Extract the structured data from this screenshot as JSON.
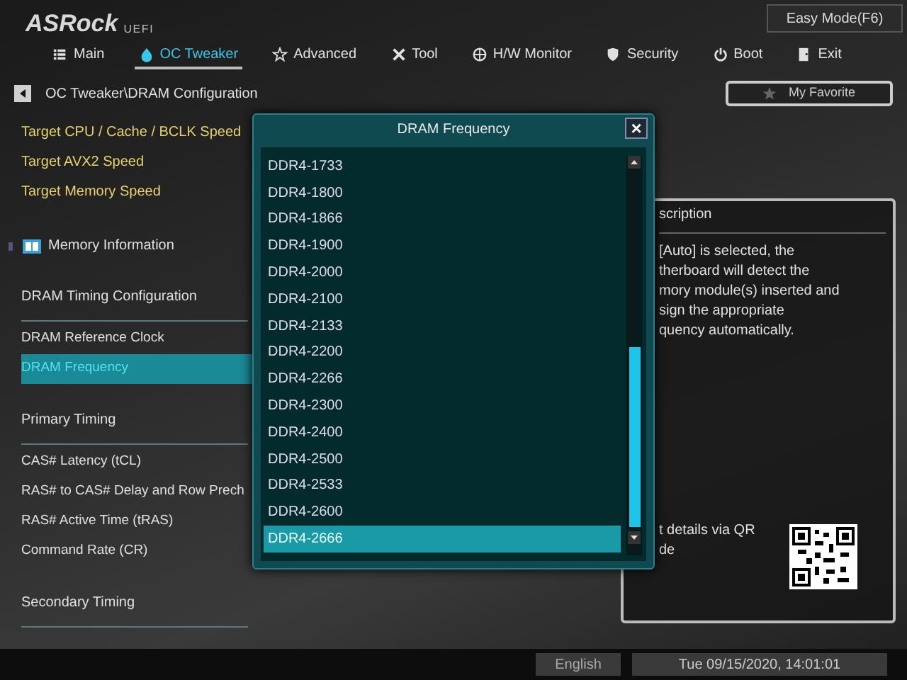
{
  "header": {
    "logo": "ASRock",
    "logo_suffix": "UEFI",
    "easy_mode_button": "Easy Mode(F6)"
  },
  "tabs": [
    {
      "label": "Main",
      "selected": false
    },
    {
      "label": "OC Tweaker",
      "selected": true
    },
    {
      "label": "Advanced",
      "selected": false
    },
    {
      "label": "Tool",
      "selected": false
    },
    {
      "label": "H/W Monitor",
      "selected": false
    },
    {
      "label": "Security",
      "selected": false
    },
    {
      "label": "Boot",
      "selected": false
    },
    {
      "label": "Exit",
      "selected": false
    }
  ],
  "breadcrumb": "OC Tweaker\\DRAM Configuration",
  "favorite_button": "My Favorite",
  "settings": [
    {
      "kind": "target",
      "label": "Target CPU / Cache / BCLK Speed",
      "selected": false
    },
    {
      "kind": "target",
      "label": "Target AVX2 Speed",
      "selected": false
    },
    {
      "kind": "target",
      "label": "Target Memory Speed",
      "selected": false
    },
    {
      "kind": "info",
      "label": "Memory Information",
      "selected": false
    },
    {
      "kind": "header",
      "label": "DRAM Timing Configuration",
      "selected": false
    },
    {
      "kind": "item",
      "label": "DRAM Reference Clock",
      "selected": false
    },
    {
      "kind": "item",
      "label": "DRAM Frequency",
      "selected": true
    },
    {
      "kind": "header",
      "label": "Primary Timing",
      "selected": false
    },
    {
      "kind": "item",
      "label": "CAS# Latency (tCL)",
      "selected": false
    },
    {
      "kind": "item",
      "label": "RAS# to CAS# Delay and Row Prech",
      "selected": false
    },
    {
      "kind": "item",
      "label": "RAS# Active Time (tRAS)",
      "selected": false
    },
    {
      "kind": "item",
      "label": "Command Rate (CR)",
      "selected": false
    },
    {
      "kind": "header",
      "label": "Secondary Timing",
      "selected": false
    }
  ],
  "popup": {
    "title": "DRAM Frequency",
    "close": "×",
    "options": [
      {
        "label": "DDR4-1733",
        "selected": false
      },
      {
        "label": "DDR4-1800",
        "selected": false
      },
      {
        "label": "DDR4-1866",
        "selected": false
      },
      {
        "label": "DDR4-1900",
        "selected": false
      },
      {
        "label": "DDR4-2000",
        "selected": false
      },
      {
        "label": "DDR4-2100",
        "selected": false
      },
      {
        "label": "DDR4-2133",
        "selected": false
      },
      {
        "label": "DDR4-2200",
        "selected": false
      },
      {
        "label": "DDR4-2266",
        "selected": false
      },
      {
        "label": "DDR4-2300",
        "selected": false
      },
      {
        "label": "DDR4-2400",
        "selected": false
      },
      {
        "label": "DDR4-2500",
        "selected": false
      },
      {
        "label": "DDR4-2533",
        "selected": false
      },
      {
        "label": "DDR4-2600",
        "selected": false
      },
      {
        "label": "DDR4-2666",
        "selected": true
      }
    ]
  },
  "description": {
    "title": "scription",
    "lines": [
      "[Auto] is selected, the",
      "therboard will detect the",
      "mory module(s) inserted and",
      "sign the appropriate",
      "quency automatically."
    ],
    "qr_lines": [
      "t details via QR",
      "de"
    ]
  },
  "status_bar": {
    "language": "English",
    "datetime": "Tue 09/15/2020, 14:01:01"
  }
}
